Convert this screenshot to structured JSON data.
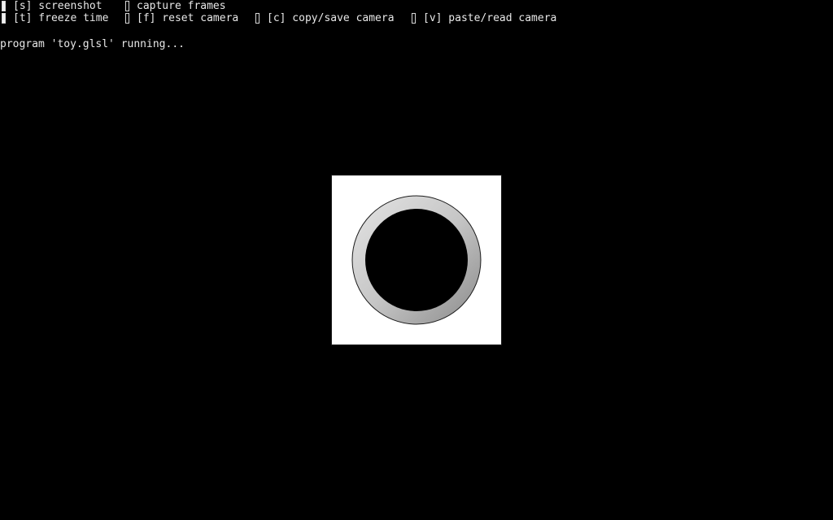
{
  "toolbar": {
    "row1": [
      {
        "key": "screenshot",
        "label": "[s] screenshot",
        "checked": true
      },
      {
        "key": "capture",
        "label": "capture frames",
        "checked": false
      }
    ],
    "row2": [
      {
        "key": "freeze",
        "label": "[t] freeze time",
        "checked": true
      },
      {
        "key": "reset",
        "label": "[f] reset camera",
        "checked": false
      },
      {
        "key": "copy",
        "label": "[c] copy/save camera",
        "checked": false
      },
      {
        "key": "paste",
        "label": "[v] paste/read camera",
        "checked": false
      }
    ]
  },
  "status": {
    "text": "program 'toy.glsl' running..."
  },
  "render": {
    "background": "#ffffff",
    "ring_color_light": "#e2e2e2",
    "ring_color_dark": "#8e8e8e",
    "center_color": "#000000"
  }
}
